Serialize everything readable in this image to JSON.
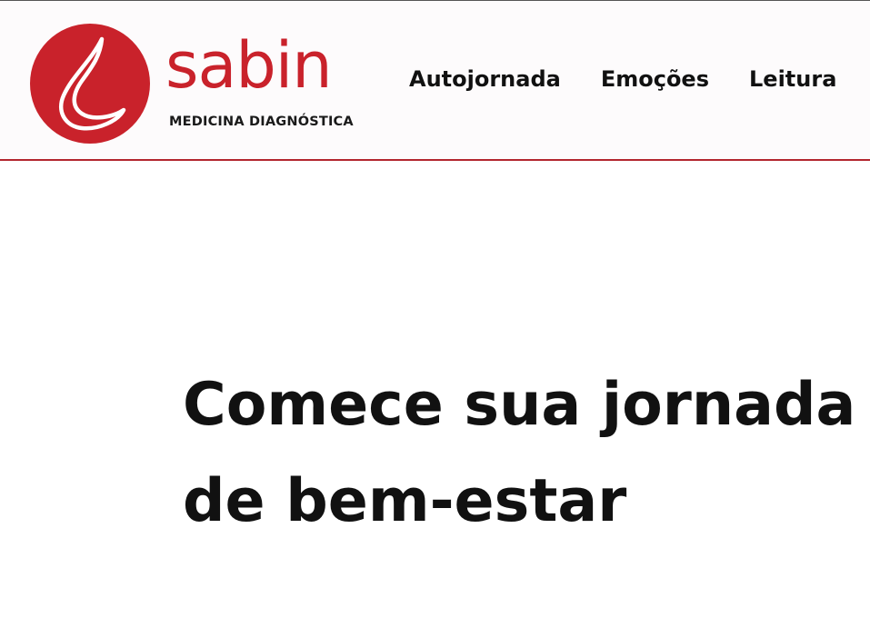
{
  "header": {
    "logo": {
      "wordmark": "sabin",
      "tagline": "MEDICINA DIAGNÓSTICA",
      "icon": "blood-drop-icon"
    },
    "nav": {
      "items": [
        {
          "label": "Autojornada"
        },
        {
          "label": "Emoções"
        },
        {
          "label": "Leitura"
        }
      ]
    }
  },
  "hero": {
    "title_line_1": "Comece sua jornada",
    "title_line_2": "de bem-estar"
  },
  "colors": {
    "brand_red": "#c9222b",
    "header_border": "#b3262e",
    "text": "#111111"
  }
}
